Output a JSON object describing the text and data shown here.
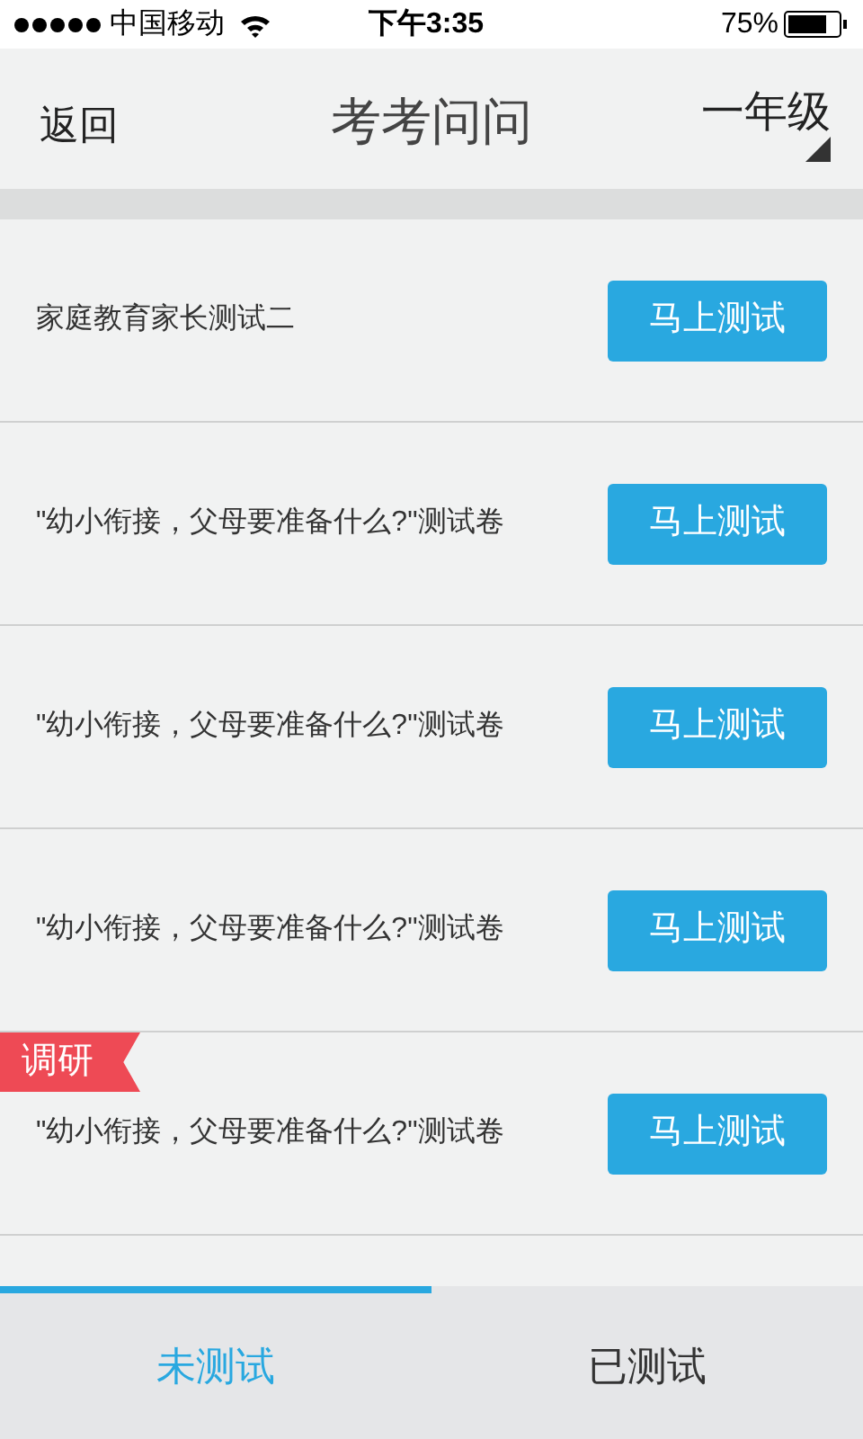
{
  "status_bar": {
    "carrier": "中国移动",
    "time": "下午3:35",
    "battery": "75%"
  },
  "header": {
    "back": "返回",
    "title": "考考问问",
    "grade": "一年级"
  },
  "rows": [
    {
      "title": "家庭教育家长测试二",
      "button": "马上测试"
    },
    {
      "title": "\"幼小衔接，父母要准备什么?\"测试卷",
      "button": "马上测试"
    },
    {
      "title": "\"幼小衔接，父母要准备什么?\"测试卷",
      "button": "马上测试"
    },
    {
      "title": "\"幼小衔接，父母要准备什么?\"测试卷",
      "button": "马上测试"
    },
    {
      "title": "\"幼小衔接，父母要准备什么?\"测试卷",
      "button": "马上测试",
      "tag": "调研"
    }
  ],
  "tabs": [
    {
      "label": "未测试",
      "selected": true
    },
    {
      "label": "已测试",
      "selected": false
    }
  ]
}
